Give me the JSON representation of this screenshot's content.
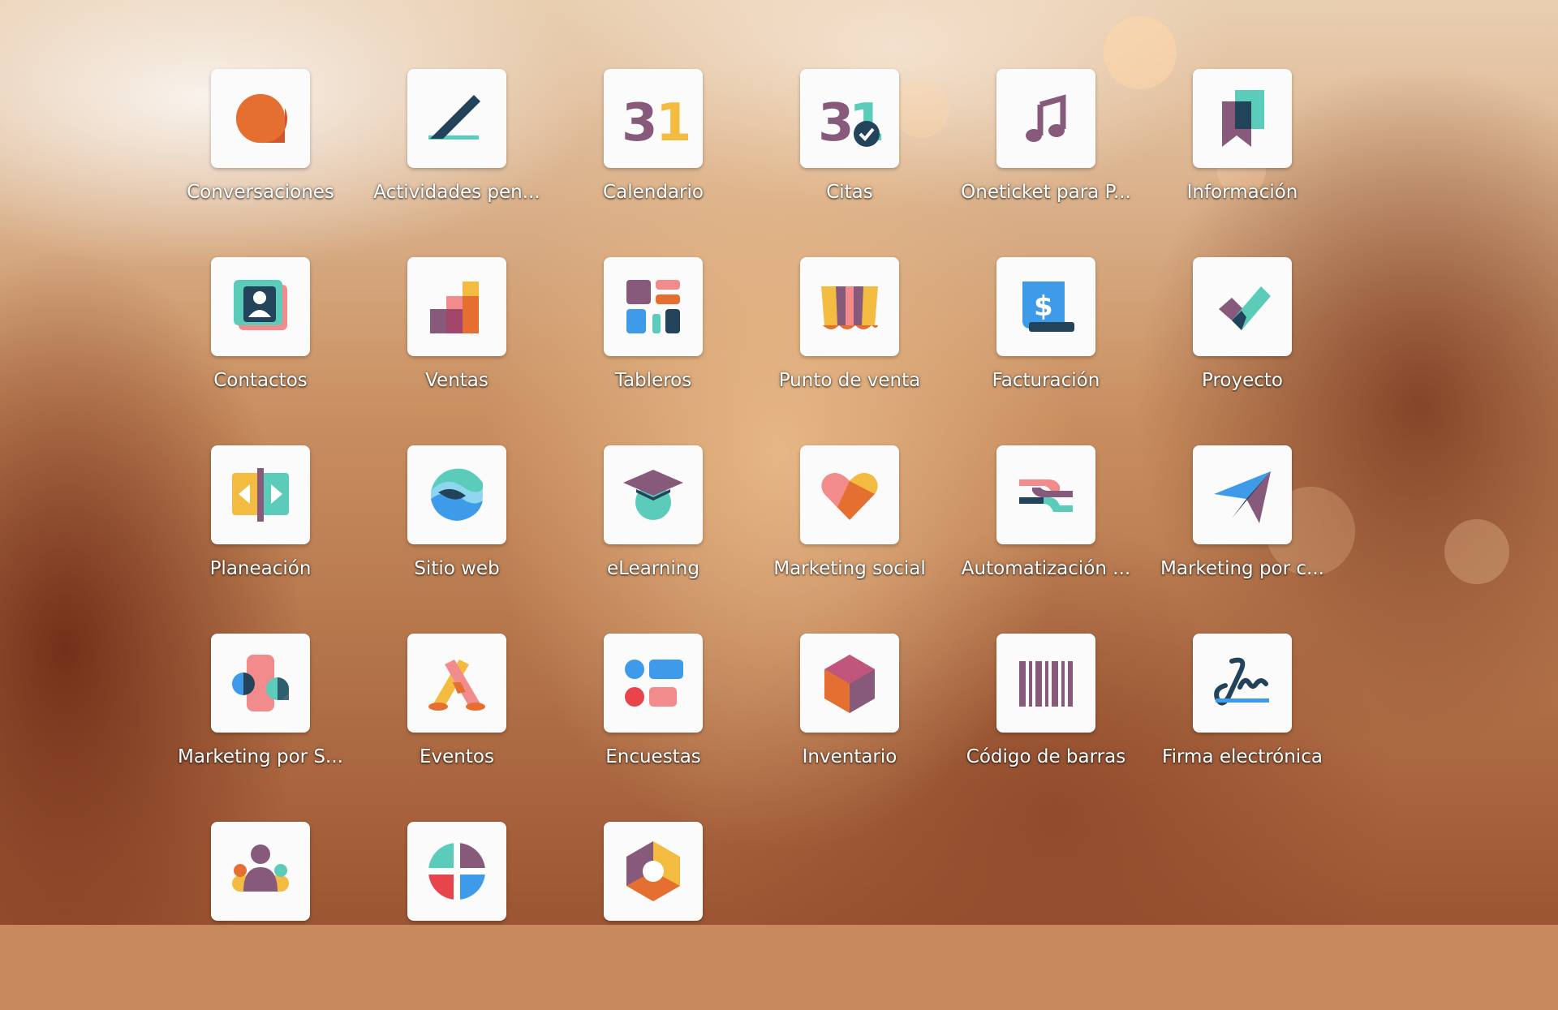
{
  "colors": {
    "purple": "#875A7B",
    "teal": "#5BCCB9",
    "orange": "#E46F31",
    "yellow": "#F4BB41",
    "pink": "#F28C8C",
    "blue": "#3D9BE9",
    "navy": "#23435B"
  },
  "apps": [
    {
      "label": "Conversaciones",
      "icon": "chat-bubble-icon"
    },
    {
      "label": "Actividades pen...",
      "icon": "pen-icon"
    },
    {
      "label": "Calendario",
      "icon": "calendar-icon"
    },
    {
      "label": "Citas",
      "icon": "appointment-icon"
    },
    {
      "label": "Oneticket para P...",
      "icon": "music-note-icon"
    },
    {
      "label": "Información",
      "icon": "bookmark-icon"
    },
    {
      "label": "Contactos",
      "icon": "contact-card-icon"
    },
    {
      "label": "Ventas",
      "icon": "bar-chart-icon"
    },
    {
      "label": "Tableros",
      "icon": "dashboard-icon"
    },
    {
      "label": "Punto de venta",
      "icon": "shop-awning-icon"
    },
    {
      "label": "Facturación",
      "icon": "invoice-icon"
    },
    {
      "label": "Proyecto",
      "icon": "checkmark-icon"
    },
    {
      "label": "Planeación",
      "icon": "planning-icon"
    },
    {
      "label": "Sitio web",
      "icon": "globe-waves-icon"
    },
    {
      "label": "eLearning",
      "icon": "graduation-cap-icon"
    },
    {
      "label": "Marketing social",
      "icon": "heart-icon"
    },
    {
      "label": "Automatización ...",
      "icon": "automation-arrows-icon"
    },
    {
      "label": "Marketing por c...",
      "icon": "paper-plane-icon"
    },
    {
      "label": "Marketing por S...",
      "icon": "sms-shapes-icon"
    },
    {
      "label": "Eventos",
      "icon": "events-icon"
    },
    {
      "label": "Encuestas",
      "icon": "survey-icon"
    },
    {
      "label": "Inventario",
      "icon": "hexagon-box-icon"
    },
    {
      "label": "Código de barras",
      "icon": "barcode-icon"
    },
    {
      "label": "Firma electrónica",
      "icon": "signature-icon"
    },
    {
      "label": "",
      "icon": "people-group-icon"
    },
    {
      "label": "",
      "icon": "quadrant-circle-icon"
    },
    {
      "label": "",
      "icon": "hexagon-ring-icon"
    }
  ]
}
